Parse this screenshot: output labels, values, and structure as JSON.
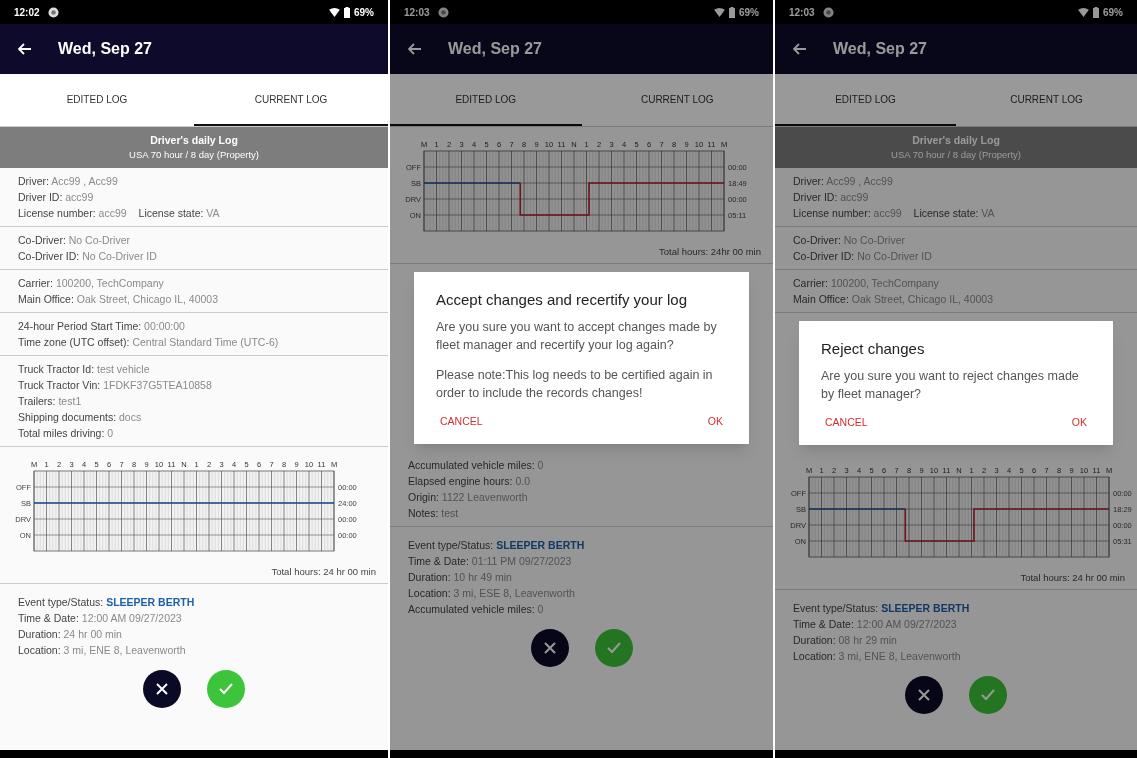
{
  "screens": [
    {
      "status_bar": {
        "time": "12:02",
        "battery": "69%"
      },
      "title": "Wed, Sep 27",
      "tabs": [
        {
          "label": "EDITED LOG",
          "selected": false
        },
        {
          "label": "CURRENT LOG",
          "selected": true
        }
      ],
      "content": [
        {
          "kind": "log_header",
          "title": "Driver's daily Log",
          "subtitle": "USA 70 hour / 8 day (Property)"
        },
        {
          "kind": "info_group",
          "rows": [
            [
              {
                "label": "Driver:",
                "value": "Acc99 , Acc99"
              }
            ],
            [
              {
                "label": "Driver ID:",
                "value": "acc99"
              }
            ],
            [
              {
                "label": "License number:",
                "value": "acc99"
              },
              {
                "label": "License state:",
                "value": "VA"
              }
            ]
          ]
        },
        {
          "kind": "info_group",
          "rows": [
            [
              {
                "label": "Co-Driver:",
                "value": "No Co-Driver"
              }
            ],
            [
              {
                "label": "Co-Driver ID:",
                "value": "No Co-Driver ID"
              }
            ]
          ]
        },
        {
          "kind": "info_group",
          "rows": [
            [
              {
                "label": "Carrier:",
                "value": "100200, TechCompany"
              }
            ],
            [
              {
                "label": "Main Office:",
                "value": "Oak Street, Chicago IL, 40003"
              }
            ]
          ]
        },
        {
          "kind": "info_group",
          "rows": [
            [
              {
                "label": "24-hour Period Start Time:",
                "value": "00:00:00"
              }
            ],
            [
              {
                "label": "Time zone (UTC offset):",
                "value": "Central Standard Time (UTC-6)"
              }
            ]
          ]
        },
        {
          "kind": "info_group",
          "rows": [
            [
              {
                "label": "Truck Tractor Id:",
                "value": "test vehicle"
              }
            ],
            [
              {
                "label": "Truck Tractor Vin:",
                "value": "1FDKF37G5TEA10858"
              }
            ],
            [
              {
                "label": "Trailers:",
                "value": "test1"
              }
            ],
            [
              {
                "label": "Shipping documents:",
                "value": "docs"
              }
            ],
            [
              {
                "label": "Total miles driving:",
                "value": "0"
              }
            ]
          ]
        },
        {
          "kind": "graph",
          "duty_line": {
            "kind": "unchanged"
          },
          "hour_labels": [
            "M",
            "1",
            "2",
            "3",
            "4",
            "5",
            "6",
            "7",
            "8",
            "9",
            "10",
            "11",
            "N",
            "1",
            "2",
            "3",
            "4",
            "5",
            "6",
            "7",
            "8",
            "9",
            "10",
            "11",
            "M"
          ],
          "status_labels": [
            "OFF",
            "SB",
            "DRV",
            "ON"
          ],
          "totals": [
            "00:00",
            "24:00",
            "00:00",
            "00:00"
          ],
          "total_hours": "Total hours: 24 hr 00 min"
        },
        {
          "kind": "event",
          "rows": [
            [
              {
                "label": "Event type/Status:",
                "value": "SLEEPER BERTH",
                "highlight": true
              }
            ],
            [
              {
                "label": "Time & Date:",
                "value": "12:00 AM 09/27/2023"
              }
            ],
            [
              {
                "label": "Duration:",
                "value": "24 hr 00 min"
              }
            ],
            [
              {
                "label": "Location:",
                "value": "3 mi, ENE 8, Leavenworth"
              }
            ]
          ]
        }
      ]
    },
    {
      "status_bar": {
        "time": "12:03",
        "battery": "69%"
      },
      "title": "Wed, Sep 27",
      "tabs": [
        {
          "label": "EDITED LOG",
          "selected": true
        },
        {
          "label": "CURRENT LOG",
          "selected": false
        }
      ],
      "content": [
        {
          "kind": "graph",
          "duty_line": {
            "kind": "edited"
          },
          "hour_labels": [
            "M",
            "1",
            "2",
            "3",
            "4",
            "5",
            "6",
            "7",
            "8",
            "9",
            "10",
            "11",
            "N",
            "1",
            "2",
            "3",
            "4",
            "5",
            "6",
            "7",
            "8",
            "9",
            "10",
            "11",
            "M"
          ],
          "status_labels": [
            "OFF",
            "SB",
            "DRV",
            "ON"
          ],
          "totals": [
            "00:00",
            "18:49",
            "00:00",
            "05:11"
          ],
          "total_hours": "Total hours: 24hr 00 min"
        },
        {
          "kind": "dialog",
          "title": "Accept changes and recertify your log",
          "paragraphs": [
            "Are you sure you want to accept changes made by fleet manager and recertify your log again?",
            "Please note:This log needs to be certified again in order to include the records changes!"
          ],
          "actions": [
            "CANCEL",
            "OK"
          ]
        },
        {
          "kind": "info_group",
          "rows": [
            [
              {
                "label": "Accumulated vehicle miles:",
                "value": "0"
              }
            ],
            [
              {
                "label": "Elapsed engine hours:",
                "value": "0.0"
              }
            ],
            [
              {
                "label": "Origin:",
                "value": "1122 Leavenworth"
              }
            ],
            [
              {
                "label": "Notes:",
                "value": "test"
              }
            ]
          ]
        },
        {
          "kind": "event",
          "rows": [
            [
              {
                "label": "Event type/Status:",
                "value": "SLEEPER BERTH",
                "highlight": true
              }
            ],
            [
              {
                "label": "Time & Date:",
                "value": "01:11 PM 09/27/2023"
              }
            ],
            [
              {
                "label": "Duration:",
                "value": "10 hr 49 min"
              }
            ],
            [
              {
                "label": "Location:",
                "value": "3 mi, ESE 8, Leavenworth"
              }
            ],
            [
              {
                "label": "Accumulated vehicle miles:",
                "value": "0"
              }
            ]
          ]
        }
      ]
    },
    {
      "status_bar": {
        "time": "12:03",
        "battery": "69%"
      },
      "title": "Wed, Sep 27",
      "tabs": [
        {
          "label": "EDITED LOG",
          "selected": true
        },
        {
          "label": "CURRENT LOG",
          "selected": false
        }
      ],
      "content": [
        {
          "kind": "log_header",
          "title": "Driver's daily Log",
          "subtitle": "USA 70 hour / 8 day (Property)"
        },
        {
          "kind": "info_group",
          "rows": [
            [
              {
                "label": "Driver:",
                "value": "Acc99 , Acc99"
              }
            ],
            [
              {
                "label": "Driver ID:",
                "value": "acc99"
              }
            ],
            [
              {
                "label": "License number:",
                "value": "acc99"
              },
              {
                "label": "License state:",
                "value": "VA"
              }
            ]
          ]
        },
        {
          "kind": "info_group",
          "rows": [
            [
              {
                "label": "Co-Driver:",
                "value": "No Co-Driver"
              }
            ],
            [
              {
                "label": "Co-Driver ID:",
                "value": "No Co-Driver ID"
              }
            ]
          ]
        },
        {
          "kind": "info_group",
          "rows": [
            [
              {
                "label": "Carrier:",
                "value": "100200, TechCompany"
              }
            ],
            [
              {
                "label": "Main Office:",
                "value": "Oak Street, Chicago IL, 40003"
              }
            ]
          ]
        },
        {
          "kind": "dialog",
          "title": "Reject changes",
          "paragraphs": [
            "Are you sure you want to reject changes made by fleet manager?"
          ],
          "actions": [
            "CANCEL",
            "OK"
          ]
        },
        {
          "kind": "graph",
          "duty_line": {
            "kind": "edited"
          },
          "hour_labels": [
            "M",
            "1",
            "2",
            "3",
            "4",
            "5",
            "6",
            "7",
            "8",
            "9",
            "10",
            "11",
            "N",
            "1",
            "2",
            "3",
            "4",
            "5",
            "6",
            "7",
            "8",
            "9",
            "10",
            "11",
            "M"
          ],
          "status_labels": [
            "OFF",
            "SB",
            "DRV",
            "ON"
          ],
          "totals": [
            "00:00",
            "18:29",
            "00:00",
            "05:31"
          ],
          "total_hours": "Total hours: 24 hr 00 min"
        },
        {
          "kind": "event",
          "rows": [
            [
              {
                "label": "Event type/Status:",
                "value": "SLEEPER BERTH",
                "highlight": true
              }
            ],
            [
              {
                "label": "Time & Date:",
                "value": "12:00 AM 09/27/2023"
              }
            ],
            [
              {
                "label": "Duration:",
                "value": "08 hr 29 min"
              }
            ],
            [
              {
                "label": "Location:",
                "value": "3 mi, ENE 8, Leavenworth"
              }
            ]
          ]
        }
      ]
    }
  ]
}
